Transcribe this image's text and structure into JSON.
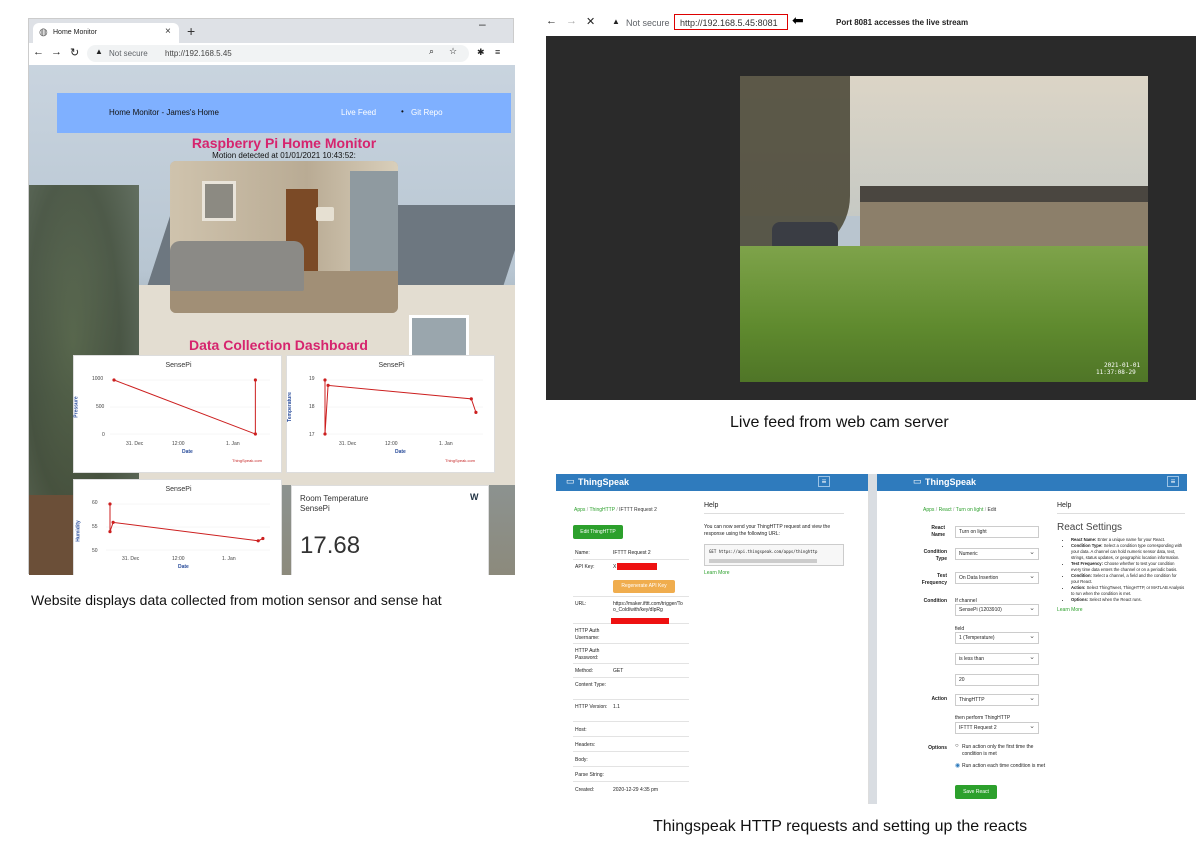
{
  "left_browser": {
    "tab_title": "Home Monitor",
    "new_tab": "+",
    "not_secure": "Not secure",
    "url": "http://192.168.5.45"
  },
  "site": {
    "nav_title": "Home Monitor - James's Home",
    "nav_live": "Live Feed",
    "nav_git": "Git Repo",
    "heading": "Raspberry Pi Home Monitor",
    "motion": "Motion detected at 01/01/2021 10:43:52:",
    "dashboard": "Data Collection Dashboard",
    "watermark": "ThingSpeak.com",
    "temp_title": "Room Temperature",
    "temp_sub": "SensePi",
    "temp_value": "17.68",
    "widget_logo": "W"
  },
  "charts": [
    {
      "type": "line",
      "title": "SensePi",
      "ylabel": "Pressure",
      "xlabel": "Date",
      "yticks": [
        "1000",
        "500",
        "0"
      ],
      "xticks": [
        "31. Dec",
        "12:00",
        "1. Jan"
      ],
      "series": [
        {
          "x": [
            0,
            0.93,
            0.93
          ],
          "y": [
            1000,
            0,
            1000
          ]
        }
      ],
      "ylim": [
        0,
        1000
      ]
    },
    {
      "type": "line",
      "title": "SensePi",
      "ylabel": "Temperature",
      "xlabel": "Date",
      "yticks": [
        "19",
        "18",
        "17"
      ],
      "xticks": [
        "31. Dec",
        "12:00",
        "1. Jan"
      ],
      "series": [
        {
          "x": [
            0,
            0,
            0.02,
            0.95,
            0.98
          ],
          "y": [
            19,
            17,
            18.8,
            18.3,
            17.8
          ]
        }
      ],
      "ylim": [
        17,
        19
      ]
    },
    {
      "type": "line",
      "title": "SensePi",
      "ylabel": "Humidity",
      "xlabel": "Date",
      "yticks": [
        "60",
        "55",
        "50"
      ],
      "xticks": [
        "31. Dec",
        "12:00",
        "1. Jan"
      ],
      "series": [
        {
          "x": [
            0,
            0,
            0.02,
            0.95,
            0.98
          ],
          "y": [
            60,
            54,
            56,
            52,
            52.5
          ]
        }
      ],
      "ylim": [
        50,
        60
      ]
    }
  ],
  "left_caption": "Website displays data collected from motion sensor and sense hat",
  "right_browser": {
    "not_secure": "Not secure",
    "url": "http://192.168.5.45:8081",
    "annotation": "Port 8081 accesses the live stream",
    "timestamp_line1": "2021-01-01",
    "timestamp_line2": "11:37:08-29"
  },
  "live_caption": "Live feed from  web cam server",
  "ts_left": {
    "brand": "ThingSpeak",
    "crumbs": [
      "Apps",
      "ThingHTTP",
      "IFTTT Request 2"
    ],
    "edit_btn": "Edit ThingHTTP",
    "regen_btn": "Regenerate API Key",
    "rows": [
      {
        "label": "Name:",
        "value": "IFTTT Request 2"
      },
      {
        "label": "API Key:",
        "value": "X"
      },
      {
        "label": "URL:",
        "value": "https://maker.ifttt.com/trigger/Too_Cold/with/key/dlpRg"
      },
      {
        "label": "HTTP Auth Username:",
        "value": ""
      },
      {
        "label": "HTTP Auth Password:",
        "value": ""
      },
      {
        "label": "Method:",
        "value": "GET"
      },
      {
        "label": "Content Type:",
        "value": ""
      },
      {
        "label": "HTTP Version:",
        "value": "1.1"
      },
      {
        "label": "Host:",
        "value": ""
      },
      {
        "label": "Headers:",
        "value": ""
      },
      {
        "label": "Body:",
        "value": ""
      },
      {
        "label": "Parse String:",
        "value": ""
      },
      {
        "label": "Created:",
        "value": "2020-12-29 4:35 pm"
      }
    ],
    "help_title": "Help",
    "help_text": "You can now send your ThingHTTP request and view the response using the following URL:",
    "help_code": "GET https://api.thingspeak.com/apps/thinghttp",
    "learn_more": "Learn More"
  },
  "ts_right": {
    "brand": "ThingSpeak",
    "crumbs": [
      "Apps",
      "React",
      "Turn on light",
      "Edit"
    ],
    "react_name_label": "React Name",
    "react_name": "Turn on light",
    "condition_type_label": "Condition Type",
    "condition_type": "Numeric",
    "test_freq_label": "Test Frequency",
    "test_freq": "On Data Insertion",
    "condition_label": "Condition",
    "if_channel": "If channel",
    "channel": "SensePi (1203910)",
    "field_label": "field",
    "field": "1 (Temperature)",
    "operator": "is less than",
    "threshold": "20",
    "action_label": "Action",
    "action": "ThingHTTP",
    "then_perform": "then perform ThingHTTP",
    "thinghttp": "IFTTT Request 2",
    "options_label": "Options",
    "option1": "Run action only the first time the condition is met",
    "option2": "Run action each time condition is met",
    "save_btn": "Save React",
    "help_title": "Help",
    "help_heading": "React Settings",
    "help_items": [
      {
        "bold": "React Name:",
        "text": " Enter a unique name for your React."
      },
      {
        "bold": "Condition Type:",
        "text": " Select a condition type corresponding with your data. A channel can hold numeric sensor data, text, strings, status updates, or geographic location information."
      },
      {
        "bold": "Test Frequency:",
        "text": " Choose whether to test your condition every time data enters the channel or on a periodic basis."
      },
      {
        "bold": "Condition:",
        "text": " Select a channel, a field and the condition for your React."
      },
      {
        "bold": "Action:",
        "text": " Select ThingTweet, ThingHTTP, or MATLAB Analysis to run when the condition is met."
      },
      {
        "bold": "Options:",
        "text": " Select when the React runs."
      }
    ],
    "learn_more": "Learn More"
  },
  "bottom_caption": "Thingspeak HTTP requests and setting up the reacts",
  "colors": {
    "nav_blue": "#7fb0ff",
    "pink": "#d6246e",
    "ts_blue": "#2f7bbd",
    "red": "#cc1f1f"
  }
}
